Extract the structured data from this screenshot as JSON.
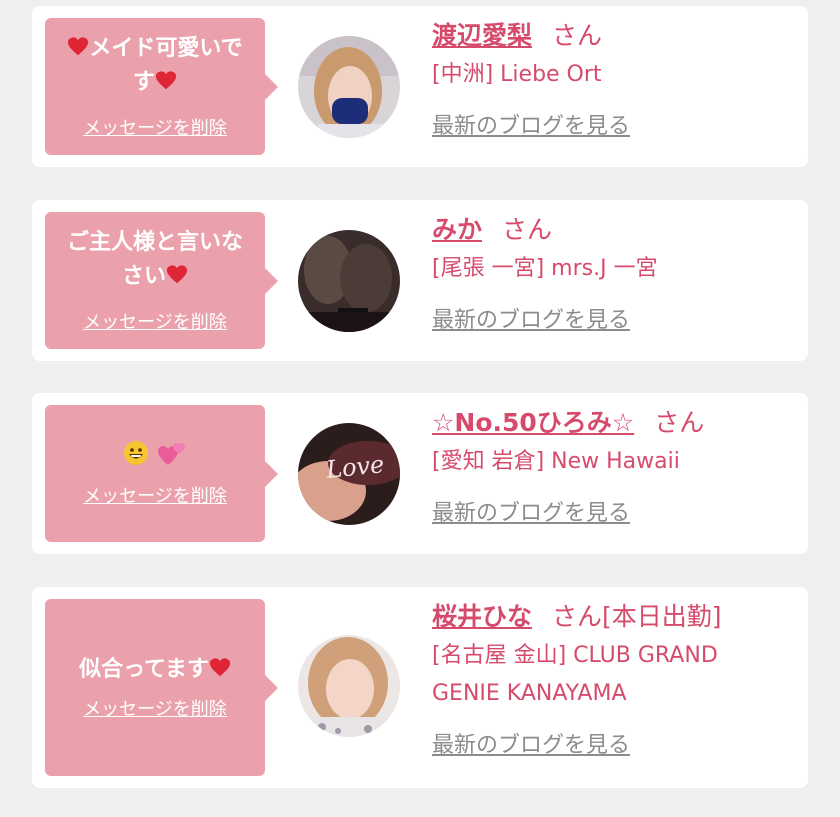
{
  "colors": {
    "accent": "#d64b6b",
    "bubble": "#eba1ac",
    "link_gray": "#8c8c8c",
    "background": "#efefef"
  },
  "icons": [
    "heart-icon",
    "grinning-face-icon",
    "two-hearts-icon"
  ],
  "items": [
    {
      "message_line1": "メイド可愛いで",
      "message_line2": "す",
      "delete_label": "メッセージを削除",
      "name": "渡辺愛梨",
      "honorific": "さん",
      "shop": "[中洲] Liebe Ort",
      "blog_link": "最新のブログを見る"
    },
    {
      "message_line1": "ご主人様と言いな",
      "message_line2": "さい",
      "delete_label": "メッセージを削除",
      "name": "みか",
      "honorific": "さん",
      "shop": "[尾張 一宮] mrs.J 一宮",
      "blog_link": "最新のブログを見る"
    },
    {
      "delete_label": "メッセージを削除",
      "name": "☆No.50ひろみ☆",
      "honorific": "さん",
      "shop": "[愛知 岩倉] New Hawaii",
      "blog_link": "最新のブログを見る",
      "avatar_text": "Love"
    },
    {
      "message_line1": "似合ってます",
      "delete_label": "メッセージを削除",
      "name": "桜井ひな",
      "honorific": "さん[本日出勤]",
      "shop_line1": "[名古屋 金山] CLUB GRAND",
      "shop_line2": "GENIE KANAYAMA",
      "blog_link": "最新のブログを見る"
    }
  ]
}
